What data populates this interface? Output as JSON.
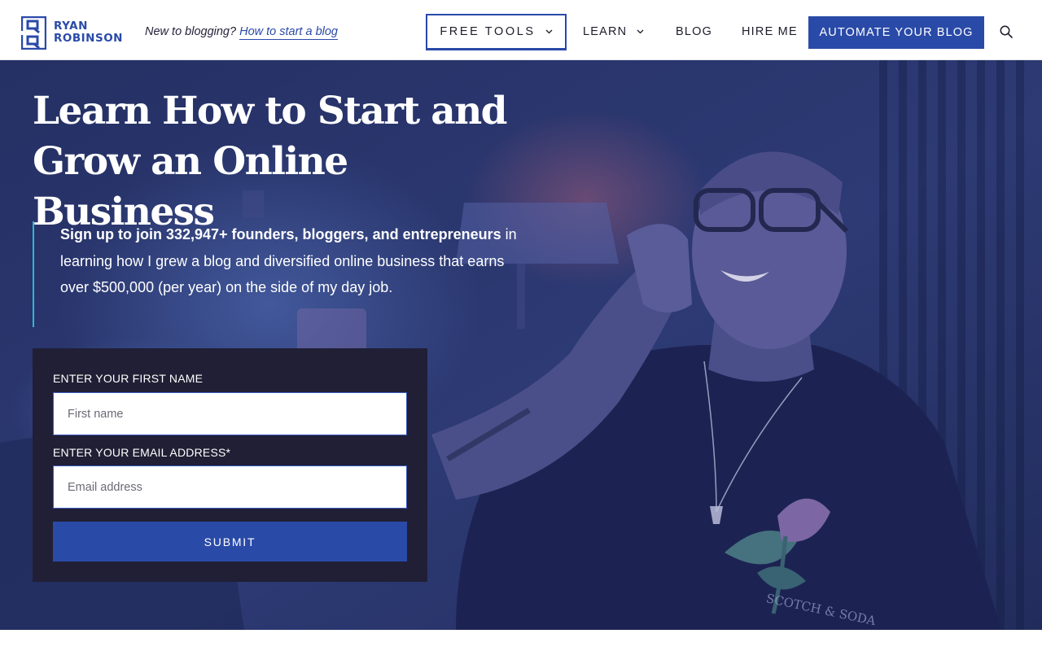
{
  "header": {
    "logo": {
      "line1": "RYAN",
      "line2": "ROBINSON"
    },
    "tagline": {
      "prefix": "New to blogging?",
      "link": "How to start a blog"
    },
    "nav": {
      "free_tools": "FREE TOOLS",
      "learn": "LEARN",
      "blog": "BLOG",
      "hire_me": "HIRE ME"
    },
    "cta": "AUTOMATE YOUR BLOG",
    "search_icon": "search-icon"
  },
  "hero": {
    "title_line1": "Learn How to Start and",
    "title_line2": "Grow an Online Business",
    "copy_bold": "Sign up to join 332,947+ founders, bloggers, and entrepreneurs",
    "copy_rest": " in learning how I grew a blog and diversified online business that earns over $500,000 (per year) on the side of my day job.",
    "shirt_text": "SCOTCH & SODA"
  },
  "form": {
    "first_name_label": "ENTER YOUR FIRST NAME",
    "first_name_placeholder": "First name",
    "email_label": "ENTER YOUR EMAIL ADDRESS*",
    "email_placeholder": "Email address",
    "submit_label": "SUBMIT"
  },
  "colors": {
    "brand_blue": "#2a4aa8",
    "hero_overlay": "#2a3566",
    "form_bg": "#201f35",
    "accent_cyan": "#2bb8d1"
  }
}
